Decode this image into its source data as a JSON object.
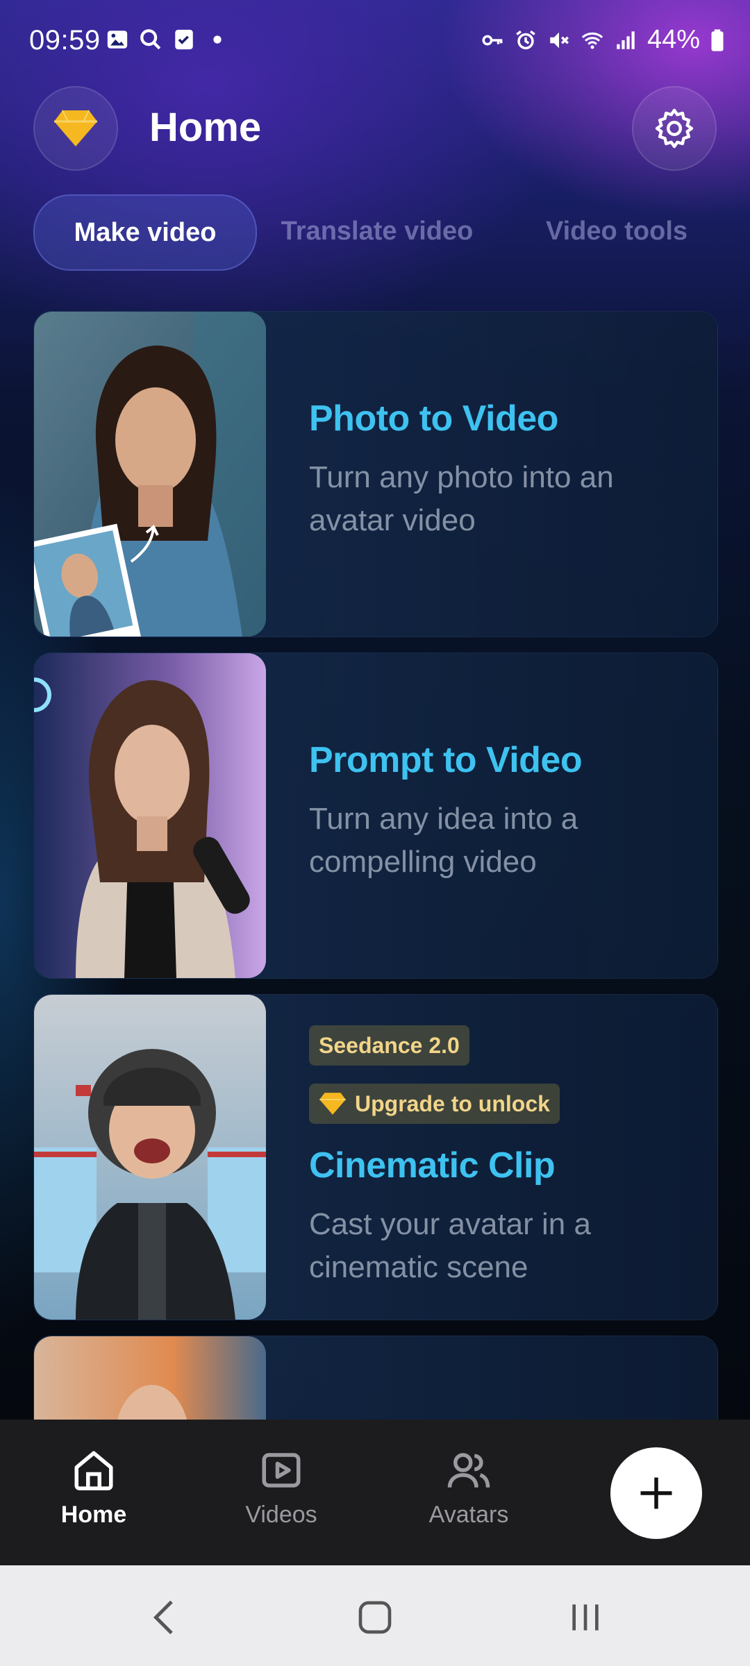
{
  "status_bar": {
    "time": "09:59",
    "battery": "44%",
    "left_icons": [
      "gallery-icon",
      "search-icon",
      "checkbox-icon",
      "dot-icon"
    ],
    "right_icons": [
      "key-icon",
      "alarm-icon",
      "mute-icon",
      "wifi-icon",
      "signal-icon",
      "battery-icon"
    ]
  },
  "header": {
    "title": "Home",
    "premium_icon": "diamond-icon",
    "settings_icon": "gear-icon"
  },
  "tabs": [
    {
      "label": "Make video",
      "active": true
    },
    {
      "label": "Translate video",
      "active": false
    },
    {
      "label": "Video tools",
      "active": false
    }
  ],
  "cards": [
    {
      "title": "Photo to Video",
      "description": "Turn any photo into an avatar video"
    },
    {
      "title": "Prompt to Video",
      "description": "Turn any idea into a compelling video"
    },
    {
      "title": "Cinematic Clip",
      "description": "Cast your avatar in a cinematic scene",
      "badge": "Seedance 2.0",
      "upgrade": "Upgrade to unlock"
    }
  ],
  "bottom_nav": {
    "items": [
      {
        "label": "Home",
        "icon": "home-icon",
        "active": true
      },
      {
        "label": "Videos",
        "icon": "play-icon",
        "active": false
      },
      {
        "label": "Avatars",
        "icon": "people-icon",
        "active": false
      }
    ],
    "fab_icon": "plus-icon"
  },
  "colors": {
    "accent": "#3ec2f0",
    "badge_text": "#f2d58a",
    "diamond": "#f5b820"
  }
}
